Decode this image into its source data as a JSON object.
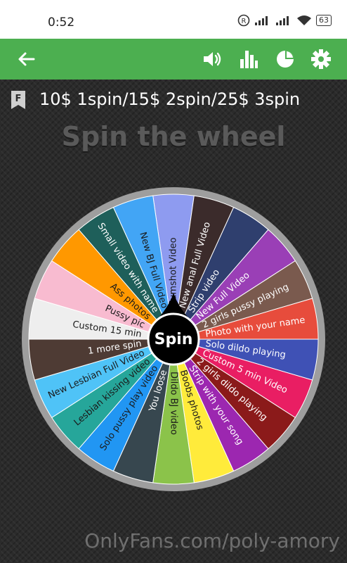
{
  "status_bar": {
    "time": "0:52",
    "battery": "63",
    "icons": [
      "registered-icon",
      "signal-icon",
      "signal-icon",
      "wifi-icon",
      "battery-icon"
    ]
  },
  "app_bar": {
    "back_icon": "arrow-left-icon",
    "actions": [
      "volume-icon",
      "stats-icon",
      "pie-chart-icon",
      "settings-icon"
    ],
    "color": "#4caf50"
  },
  "wheel_title": "10$ 1spin/15$ 2spin/25$ 3spin",
  "heading": "Spin the wheel",
  "spin_label": "Spin",
  "segments": [
    {
      "label": "Cumshot Video",
      "color": "#8e9bf0",
      "text": "#1a1a1a"
    },
    {
      "label": "New anal Full Video",
      "color": "#3b2b2b",
      "text": "#ffffff"
    },
    {
      "label": "Strip video",
      "color": "#2f3f6e",
      "text": "#ffffff"
    },
    {
      "label": "New Full Video",
      "color": "#9a3fb6",
      "text": "#ffffff"
    },
    {
      "label": "2 girls pussy playing",
      "color": "#7a5a4e",
      "text": "#ffffff"
    },
    {
      "label": "Photo with your name",
      "color": "#e74c3c",
      "text": "#ffffff"
    },
    {
      "label": "Solo dildo playing",
      "color": "#3f51b5",
      "text": "#ffffff"
    },
    {
      "label": "Custom 5 min Video",
      "color": "#e91e63",
      "text": "#ffffff"
    },
    {
      "label": "2 girls dildo playing",
      "color": "#8b1a1a",
      "text": "#ffffff"
    },
    {
      "label": "Strip with your song",
      "color": "#9c27b0",
      "text": "#ffffff"
    },
    {
      "label": "Boobs photos",
      "color": "#ffeb3b",
      "text": "#1a1a1a"
    },
    {
      "label": "Dildo BJ video",
      "color": "#8bc34a",
      "text": "#1a1a1a"
    },
    {
      "label": "You loose",
      "color": "#37474f",
      "text": "#ffffff"
    },
    {
      "label": "Solo pussy play video",
      "color": "#2196f3",
      "text": "#1a1a1a"
    },
    {
      "label": "Lesbian kissing video",
      "color": "#26a69a",
      "text": "#1a1a1a"
    },
    {
      "label": "New Lesbian Full Video",
      "color": "#4fc3f7",
      "text": "#1a1a1a"
    },
    {
      "label": "1 more spin",
      "color": "#4e3b34",
      "text": "#ffffff"
    },
    {
      "label": "Custom 15 min",
      "color": "#eeeeee",
      "text": "#1a1a1a"
    },
    {
      "label": "Pussy pic",
      "color": "#f8bbd0",
      "text": "#1a1a1a"
    },
    {
      "label": "Ass photos",
      "color": "#ff9800",
      "text": "#1a1a1a"
    },
    {
      "label": "Small video with name",
      "color": "#1e5f5a",
      "text": "#ffffff"
    },
    {
      "label": "New BJ Full Video",
      "color": "#42a5f5",
      "text": "#1a1a1a"
    }
  ],
  "watermark": "OnlyFans.com/poly-amory"
}
